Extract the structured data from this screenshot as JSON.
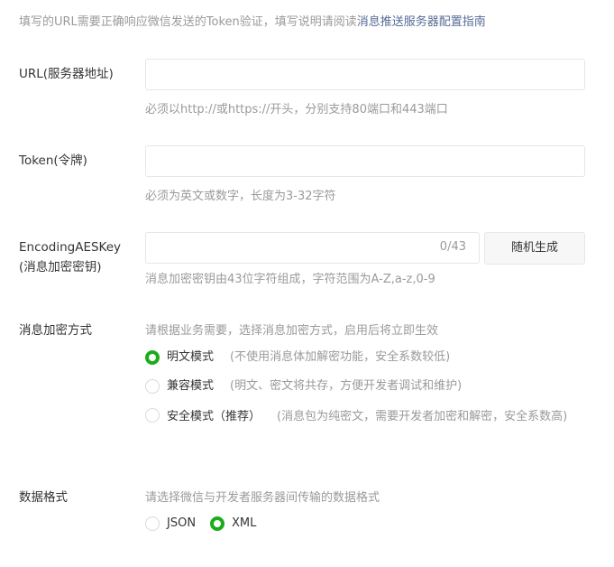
{
  "intro": {
    "text": "填写的URL需要正确响应微信发送的Token验证，填写说明请阅读",
    "link": "消息推送服务器配置指南"
  },
  "url": {
    "label": "URL(服务器地址)",
    "value": "",
    "help": "必须以http://或https://开头，分别支持80端口和443端口"
  },
  "token": {
    "label": "Token(令牌)",
    "value": "",
    "help": "必须为英文或数字，长度为3-32字符"
  },
  "aes": {
    "label1": "EncodingAESKey",
    "label2": "(消息加密密钥)",
    "value": "",
    "counter": "0/43",
    "generate": "随机生成",
    "help": "消息加密密钥由43位字符组成，字符范围为A-Z,a-z,0-9"
  },
  "encryption": {
    "label": "消息加密方式",
    "hint": "请根据业务需要，选择消息加密方式，启用后将立即生效",
    "options": [
      {
        "label": "明文模式",
        "desc": "(不使用消息体加解密功能，安全系数较低)",
        "selected": true
      },
      {
        "label": "兼容模式",
        "desc": "(明文、密文将共存，方便开发者调试和维护)",
        "selected": false
      },
      {
        "label": "安全模式（推荐）",
        "desc": "(消息包为纯密文，需要开发者加密和解密，安全系数高)",
        "selected": false
      }
    ]
  },
  "format": {
    "label": "数据格式",
    "hint": "请选择微信与开发者服务器间传输的数据格式",
    "options": [
      {
        "label": "JSON",
        "selected": false
      },
      {
        "label": "XML",
        "selected": true
      }
    ]
  },
  "colors": {
    "accent": "#1aad19",
    "link": "#576b95"
  }
}
